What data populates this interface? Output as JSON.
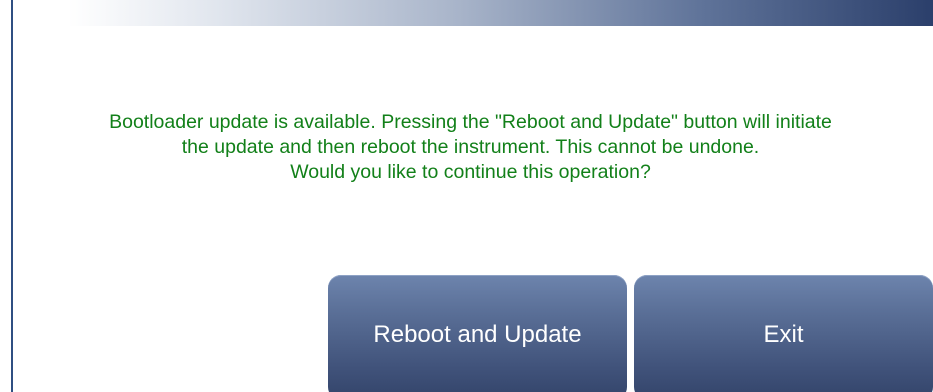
{
  "dialog": {
    "message_lines": [
      "Bootloader update is available. Pressing the \"Reboot and Update\" button will initiate",
      "the update and then reboot the instrument. This cannot be undone.",
      "Would you like to continue this operation?"
    ],
    "text_color": "#128019"
  },
  "buttons": {
    "reboot_label": "Reboot and Update",
    "exit_label": "Exit"
  },
  "colors": {
    "header_gradient_end": "#2b3f6b",
    "button_top": "#6d84ad",
    "button_bottom": "#33446a"
  }
}
